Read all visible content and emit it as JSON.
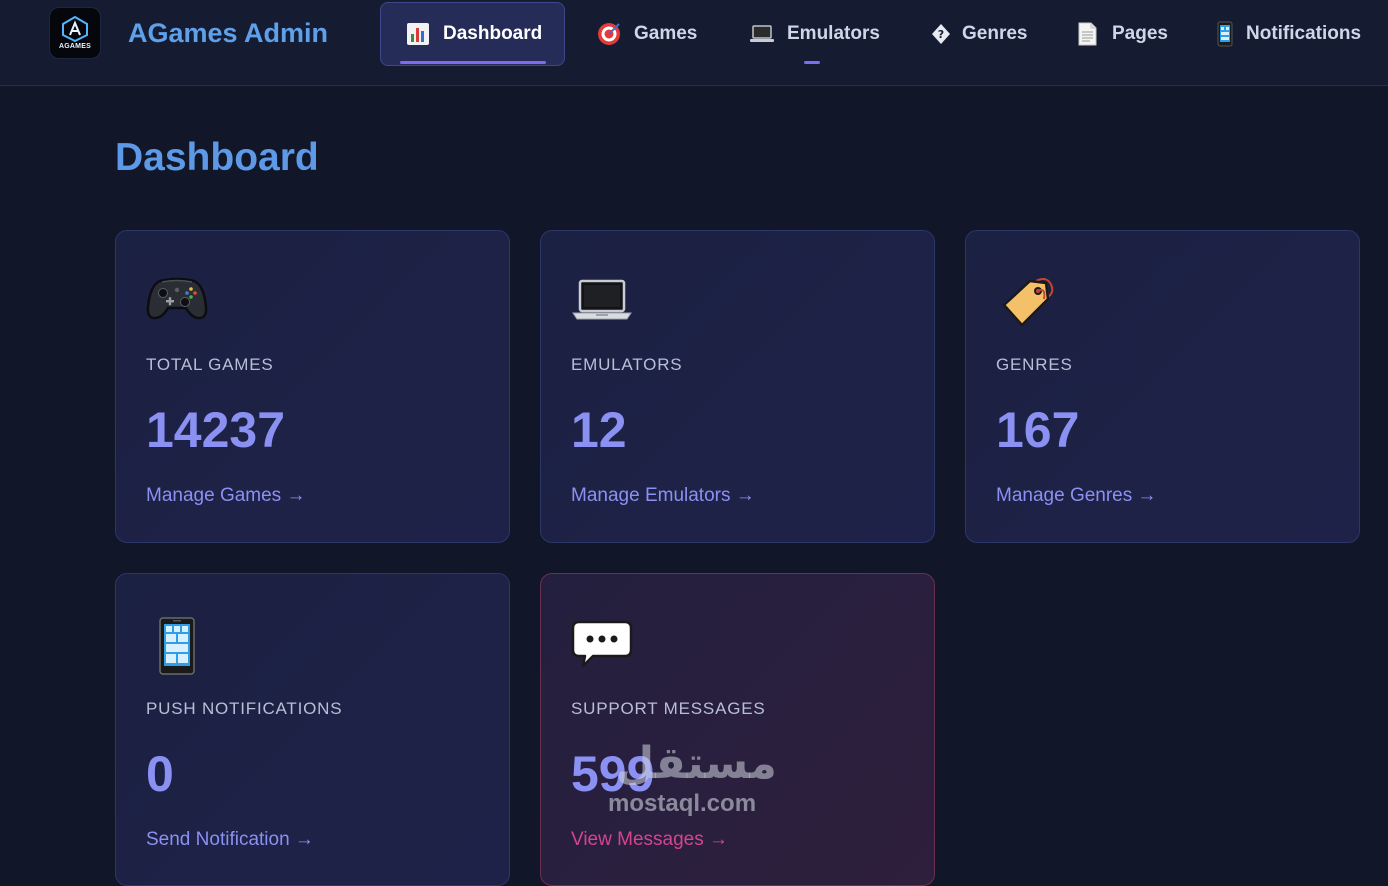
{
  "header": {
    "logo_text": "AGAMES",
    "title": "AGames Admin"
  },
  "nav": {
    "items": [
      {
        "label": "Dashboard",
        "icon": "bar-chart-icon",
        "active": true
      },
      {
        "label": "Games",
        "icon": "target-icon",
        "active": false
      },
      {
        "label": "Emulators",
        "icon": "laptop-icon",
        "active": false
      },
      {
        "label": "Genres",
        "icon": "diamond-question-icon",
        "active": false
      },
      {
        "label": "Pages",
        "icon": "page-icon",
        "active": false
      },
      {
        "label": "Notifications",
        "icon": "phone-icon",
        "active": false
      }
    ]
  },
  "main": {
    "title": "Dashboard",
    "cards": [
      {
        "icon": "gamepad-icon",
        "label": "TOTAL GAMES",
        "value": "14237",
        "link": "Manage Games →"
      },
      {
        "icon": "laptop-icon",
        "label": "EMULATORS",
        "value": "12",
        "link": "Manage Emulators →"
      },
      {
        "icon": "tag-icon",
        "label": "GENRES",
        "value": "167",
        "link": "Manage Genres →"
      },
      {
        "icon": "phone-icon",
        "label": "PUSH NOTIFICATIONS",
        "value": "0",
        "link": "Send Notification →"
      },
      {
        "icon": "speech-bubble-icon",
        "label": "SUPPORT MESSAGES",
        "value": "599",
        "link": "View Messages →"
      }
    ]
  },
  "watermark": {
    "arabic": "مستقل",
    "latin": "mostaql.com"
  },
  "colors": {
    "background": "#111729",
    "accent": "#8b90f3",
    "title": "#5d99e6",
    "support_accent": "#d4458f"
  }
}
